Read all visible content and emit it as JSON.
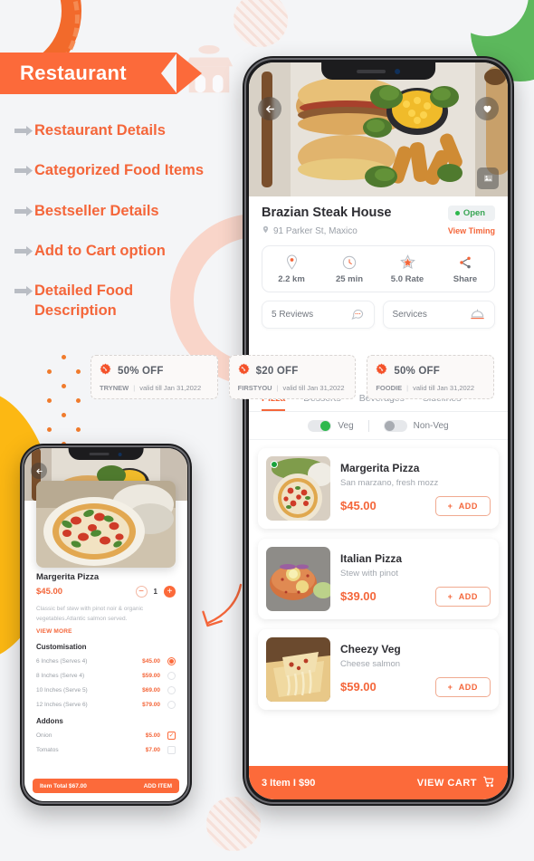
{
  "banner": {
    "title": "Restaurant"
  },
  "features": [
    {
      "label": "Restaurant Details"
    },
    {
      "label": "Categorized Food Items"
    },
    {
      "label": "Bestseller Details"
    },
    {
      "label": "Add to Cart option"
    },
    {
      "label": "Detailed Food Description"
    }
  ],
  "main_phone": {
    "hero": {
      "back_icon": "back-arrow-icon",
      "favorite_icon": "heart-icon",
      "gallery_icon": "gallery-icon"
    },
    "restaurant": {
      "name": "Brazian Steak House",
      "status": "Open",
      "address": "91 Parker St, Maxico",
      "view_timing": "View Timing",
      "location_icon": "location-pin-icon"
    },
    "stats": [
      {
        "icon": "distance-pin-icon",
        "label": "2.2 km"
      },
      {
        "icon": "clock-icon",
        "label": "25 min"
      },
      {
        "icon": "star-icon",
        "label": "5.0 Rate"
      },
      {
        "icon": "share-icon",
        "label": "Share"
      }
    ],
    "pills": [
      {
        "label": "5 Reviews",
        "icon": "chat-bubble-icon"
      },
      {
        "label": "Services",
        "icon": "food-cover-icon"
      }
    ],
    "tabs": [
      {
        "label": "Pizza",
        "active": true
      },
      {
        "label": "Desserts",
        "active": false
      },
      {
        "label": "Beverages",
        "active": false
      },
      {
        "label": "Sidelines",
        "active": false
      }
    ],
    "toggles": [
      {
        "label": "Veg",
        "on": true
      },
      {
        "label": "Non-Veg",
        "on": false
      }
    ],
    "food_items": [
      {
        "name": "Margerita Pizza",
        "desc": "San marzano, fresh mozz",
        "price": "$45.00",
        "add_label": "ADD",
        "veg": true
      },
      {
        "name": "Italian Pizza",
        "desc": "Stew with pinot",
        "price": "$39.00",
        "add_label": "ADD",
        "veg": false
      },
      {
        "name": "Cheezy Veg",
        "desc": "Cheese salmon",
        "price": "$59.00",
        "add_label": "ADD",
        "veg": false
      }
    ],
    "cart_bar": {
      "summary": "3 Item  I  $90",
      "action": "VIEW CART",
      "cart_icon": "shopping-cart-icon"
    }
  },
  "offers": [
    {
      "amount": "50% OFF",
      "code": "TRYNEW",
      "validity": "valid till Jan 31,2022",
      "icon": "discount-badge-icon"
    },
    {
      "amount": "$20 OFF",
      "code": "FIRSTYOU",
      "validity": "valid till Jan 31,2022",
      "icon": "discount-badge-icon"
    },
    {
      "amount": "50% OFF",
      "code": "FOODIE",
      "validity": "valid till Jan 31,2022",
      "icon": "discount-badge-icon"
    }
  ],
  "detail_phone": {
    "back_icon": "back-arrow-icon",
    "item_name": "Margerita Pizza",
    "item_price": "$45.00",
    "quantity": "1",
    "description": "Classic bef stew with pinot noir & organic vegetables.Atlantic salmon served.",
    "view_more": "VIEW MORE",
    "customisation_title": "Customisation",
    "customisation": [
      {
        "label": "6 Inches (Serves 4)",
        "price": "$45.00",
        "selected": true
      },
      {
        "label": "8 Inches  (Serve 4)",
        "price": "$59.00",
        "selected": false
      },
      {
        "label": "10 Inches  (Serve 5)",
        "price": "$69.00",
        "selected": false
      },
      {
        "label": "12 Inches  (Serve 6)",
        "price": "$79.00",
        "selected": false
      }
    ],
    "addons_title": "Addons",
    "addons": [
      {
        "label": "Onion",
        "price": "$5.00",
        "checked": true
      },
      {
        "label": "Tomatos",
        "price": "$7.00",
        "checked": false
      }
    ],
    "total_label": "Item Total $67.00",
    "add_item_label": "ADD ITEM"
  },
  "colors": {
    "accent": "#fc6a3a",
    "accent_text": "#f4663a",
    "green": "#2db84d",
    "background": "#f4f5f7",
    "yellow": "#fcb813"
  }
}
